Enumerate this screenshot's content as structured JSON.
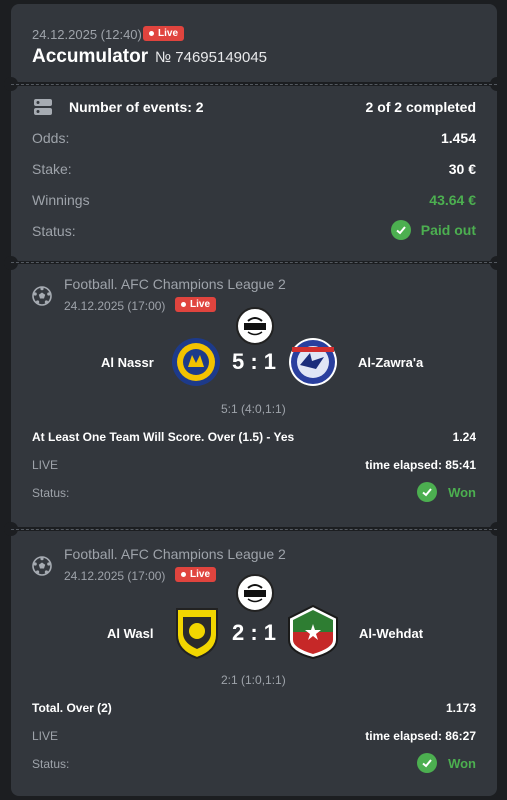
{
  "header": {
    "datetime": "24.12.2025 (12:40)",
    "live_label": "Live",
    "title": "Accumulator",
    "bet_number": "№ 74695149045"
  },
  "summary": {
    "events_label": "Number of events: 2",
    "completed": "2 of 2 completed",
    "rows": [
      {
        "label": "Odds:",
        "value": "1.454"
      },
      {
        "label": "Stake:",
        "value": "30 €"
      },
      {
        "label": "Winnings",
        "value": "43.64 €"
      },
      {
        "label": "Status:",
        "value": "Paid out"
      }
    ],
    "accent": "#4caf50"
  },
  "events": [
    {
      "league": "Football. AFC Champions League 2",
      "datetime": "24.12.2025 (17:00)",
      "live_label": "Live",
      "home": "Al Nassr",
      "away": "Al-Zawra'a",
      "score": "5 : 1",
      "score_detail": "5:1 (4:0,1:1)",
      "market": "At Least One Team Will Score. Over (1.5) - Yes",
      "odds": "1.24",
      "state": "LIVE",
      "elapsed": "time elapsed: 85:41",
      "status_label": "Status:",
      "status": "Won"
    },
    {
      "league": "Football. AFC Champions League 2",
      "datetime": "24.12.2025 (17:00)",
      "live_label": "Live",
      "home": "Al Wasl",
      "away": "Al-Wehdat",
      "score": "2 : 1",
      "score_detail": "2:1 (1:0,1:1)",
      "market": "Total. Over (2)",
      "odds": "1.173",
      "state": "LIVE",
      "elapsed": "time elapsed: 86:27",
      "status_label": "Status:",
      "status": "Won"
    }
  ]
}
